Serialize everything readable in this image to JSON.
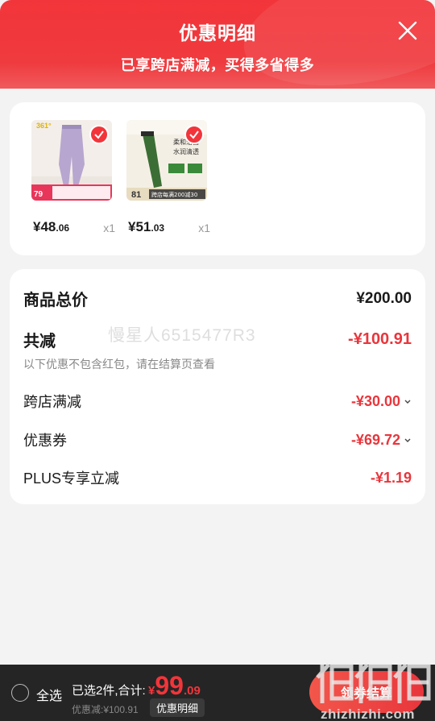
{
  "header": {
    "title": "优惠明细",
    "subtitle": "已享跨店满减，买得多省得多"
  },
  "products": [
    {
      "price_int": "¥48",
      "price_dec": ".06",
      "qty": "x1",
      "thumb_badge": "79",
      "thumb_brand": "361°"
    },
    {
      "price_int": "¥51",
      "price_dec": ".03",
      "qty": "x1",
      "thumb_badge": "81",
      "thumb_caption": "跨店每满200减30",
      "thumb_title": "柔和洁面"
    }
  ],
  "summary": {
    "total_label": "商品总价",
    "total_value": "¥200.00",
    "reduce_label": "共减",
    "reduce_value": "-¥100.91",
    "note": "以下优惠不包含红包，请在结算页查看",
    "watermark": "慢星人6515477R3",
    "items": [
      {
        "label": "跨店满减",
        "value": "-¥30.00",
        "expandable": true
      },
      {
        "label": "优惠券",
        "value": "-¥69.72",
        "expandable": true
      },
      {
        "label": "PLUS专享立减",
        "value": "-¥1.19",
        "expandable": false
      }
    ]
  },
  "footer": {
    "select_all": "全选",
    "selected_info": "已选2件,合计:",
    "total_currency": "¥",
    "total_int": "99",
    "total_dec": ".09",
    "discount_text": "优惠减:¥100.91",
    "detail_button": "优惠明细",
    "checkout_button": "领券结算",
    "watermark_text": "zhizhizhi.com"
  },
  "colors": {
    "accent": "#f2353a",
    "footer_bg": "#252525"
  }
}
